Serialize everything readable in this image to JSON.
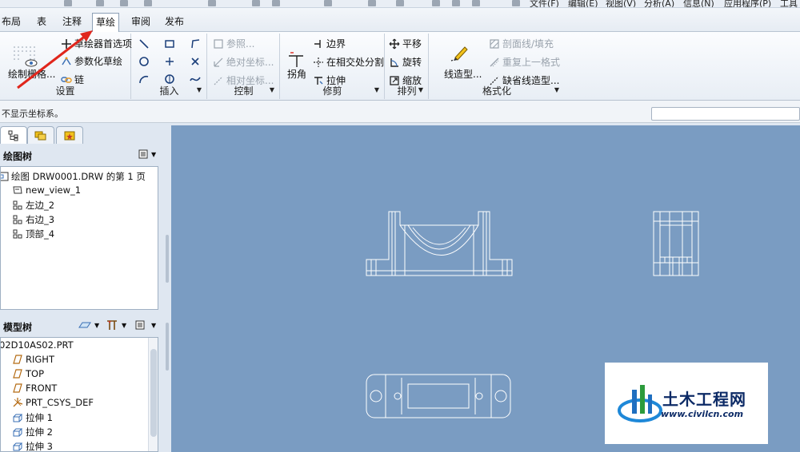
{
  "quick_access": {
    "menus": [
      "文件(F)",
      "编辑(E)",
      "视图(V)",
      "分析(A)",
      "信息(N)",
      "应用程序(P)",
      "工具"
    ]
  },
  "tabs": [
    {
      "label": "布局",
      "active": false
    },
    {
      "label": "表",
      "active": false
    },
    {
      "label": "注释",
      "active": false
    },
    {
      "label": "草绘",
      "active": true
    },
    {
      "label": "审阅",
      "active": false
    },
    {
      "label": "发布",
      "active": false
    }
  ],
  "ribbon": {
    "settings": {
      "label": "设置",
      "draw_grid": "绘制栅格...",
      "sketcher_prefs": "草绘器首选项",
      "param_sketch": "参数化草绘",
      "chain": "链"
    },
    "insert": {
      "label": "插入"
    },
    "control": {
      "label": "控制",
      "ref": "参照...",
      "abs_coord": "绝对坐标...",
      "rel_coord": "相对坐标..."
    },
    "trim": {
      "label": "修剪",
      "corner": "拐角",
      "boundary": "边界",
      "split_at_intersect": "在相交处分割",
      "stretch": "拉伸"
    },
    "arrange": {
      "label": "排列",
      "translate": "平移",
      "rotate": "旋转",
      "scale": "缩放"
    },
    "format": {
      "label": "格式化",
      "line_style": "线造型...",
      "hatch": "剖面线/填充",
      "repeat_last": "重复上一格式",
      "default_line": "缺省线造型..."
    }
  },
  "message": "不显示坐标系。",
  "drawing_tree": {
    "title": "绘图树",
    "items": [
      {
        "label": "绘图 DRW0001.DRW 的第 1 页",
        "icon": "drawing-page-icon"
      },
      {
        "label": "new_view_1",
        "icon": "view-icon"
      },
      {
        "label": "左边_2",
        "icon": "view-icon"
      },
      {
        "label": "右边_3",
        "icon": "view-icon"
      },
      {
        "label": "顶部_4",
        "icon": "view-icon"
      }
    ]
  },
  "model_tree": {
    "title": "模型树",
    "items": [
      {
        "label": "02D10AS02.PRT",
        "icon": "part-icon"
      },
      {
        "label": "RIGHT",
        "icon": "datum-plane-icon"
      },
      {
        "label": "TOP",
        "icon": "datum-plane-icon"
      },
      {
        "label": "FRONT",
        "icon": "datum-plane-icon"
      },
      {
        "label": "PRT_CSYS_DEF",
        "icon": "csys-icon"
      },
      {
        "label": "拉伸 1",
        "icon": "extrude-icon"
      },
      {
        "label": "拉伸 2",
        "icon": "extrude-icon"
      },
      {
        "label": "拉伸 3",
        "icon": "extrude-icon"
      }
    ]
  },
  "watermark": {
    "title": "土木工程网",
    "url": "www.civilcn.com"
  },
  "colors": {
    "canvas": "#7a9cc2",
    "annotation_arrow": "#e0261c",
    "watermark_text": "#0c2a66"
  }
}
